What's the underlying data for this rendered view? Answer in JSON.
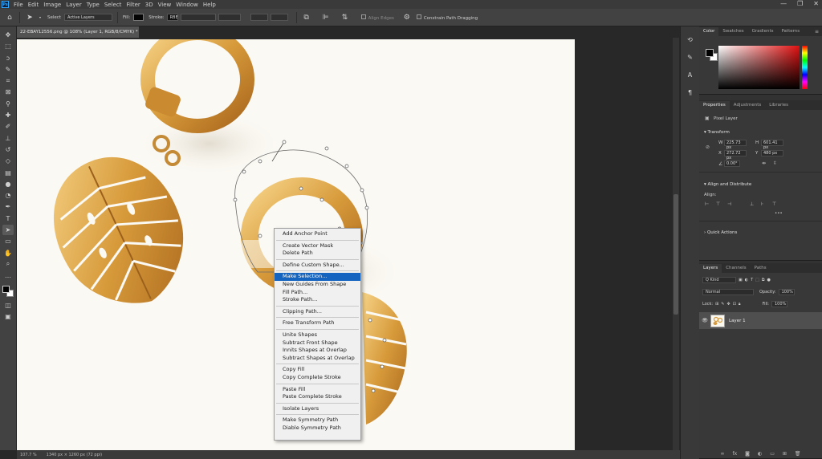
{
  "menubar": {
    "items": [
      "File",
      "Edit",
      "Image",
      "Layer",
      "Type",
      "Select",
      "Filter",
      "3D",
      "View",
      "Window",
      "Help"
    ],
    "logo": "Ps",
    "window_controls": {
      "minimize": "—",
      "restore": "❐",
      "close": "✕"
    }
  },
  "options": {
    "select_label": "Select",
    "select_value": "Active Layers",
    "fill_label": "Fill:",
    "stroke_label": "Stroke:",
    "stroke_value": "RBE",
    "align_edges": "Align Edges",
    "constrain": "Constrain Path Dragging"
  },
  "document": {
    "tab_title": "22-EBAY12556.png @ 108% (Layer 1, RGB/8/CMYK) *",
    "tab_close": "×"
  },
  "context_menu": {
    "items": [
      "Add Anchor Point",
      "---",
      "Create Vector Mask",
      "Delete Path",
      "---",
      "Define Custom Shape...",
      "---",
      "Make Selection...",
      "New Guides From Shape",
      "Fill Path...",
      "Stroke Path...",
      "---",
      "Clipping Path...",
      "---",
      "Free Transform Path",
      "---",
      "Unite Shapes",
      "Subtract Front Shape",
      "Innits Shapes at Overlap",
      "Subtract Shapes at Overlap",
      "---",
      "Copy Fill",
      "Copy Complete Stroke",
      "---",
      "Paste Fill",
      "Paste Complete Stroke",
      "---",
      "Isolate Layers",
      "---",
      "Make Symmetry Path",
      "Diable Symmetry Path"
    ],
    "highlighted": "Make Selection..."
  },
  "status": {
    "zoom": "107.7 %",
    "dimensions": "1340 px × 1260 px (72 ppi)"
  },
  "color_panel": {
    "tabs": [
      "Color",
      "Swatches",
      "Gradients",
      "Patterns"
    ],
    "active": "Color",
    "menu": "≡"
  },
  "properties_panel": {
    "tabs": [
      "Properties",
      "Adjustments",
      "Libraries"
    ],
    "active": "Properties",
    "layer_kind": "Pixel Layer",
    "transform_title": "Transform",
    "w_label": "W",
    "w_value": "225.73 px",
    "h_label": "H",
    "h_value": "601.41 px",
    "x_label": "X",
    "x_value": "272.72 px",
    "y_label": "Y",
    "y_value": "480 px",
    "angle_value": "0.00°",
    "align_title": "Align and Distribute",
    "align_label": "Align:",
    "more": "•••",
    "quick_actions": "Quick Actions"
  },
  "layers_panel": {
    "tabs": [
      "Layers",
      "Channels",
      "Paths"
    ],
    "active": "Layers",
    "kind_filter": "Q Kind",
    "blend_mode": "Normal",
    "opacity_label": "Opacity:",
    "opacity_value": "100%",
    "lock_label": "Lock:",
    "fill_label": "Fill:",
    "fill_value": "100%",
    "layers": [
      {
        "name": "Layer 1",
        "visible": true
      }
    ]
  },
  "tools": [
    "move-tool",
    "artboard-tool",
    "marquee-tool",
    "lasso-tool",
    "quick-selection-tool",
    "crop-tool",
    "frame-tool",
    "eyedropper-tool",
    "healing-brush-tool",
    "brush-tool",
    "clone-stamp-tool",
    "history-brush-tool",
    "eraser-tool",
    "gradient-tool",
    "blur-tool",
    "dodge-tool",
    "pen-tool",
    "type-tool",
    "path-selection-tool",
    "rectangle-tool",
    "hand-tool",
    "zoom-tool",
    "more-tools"
  ]
}
